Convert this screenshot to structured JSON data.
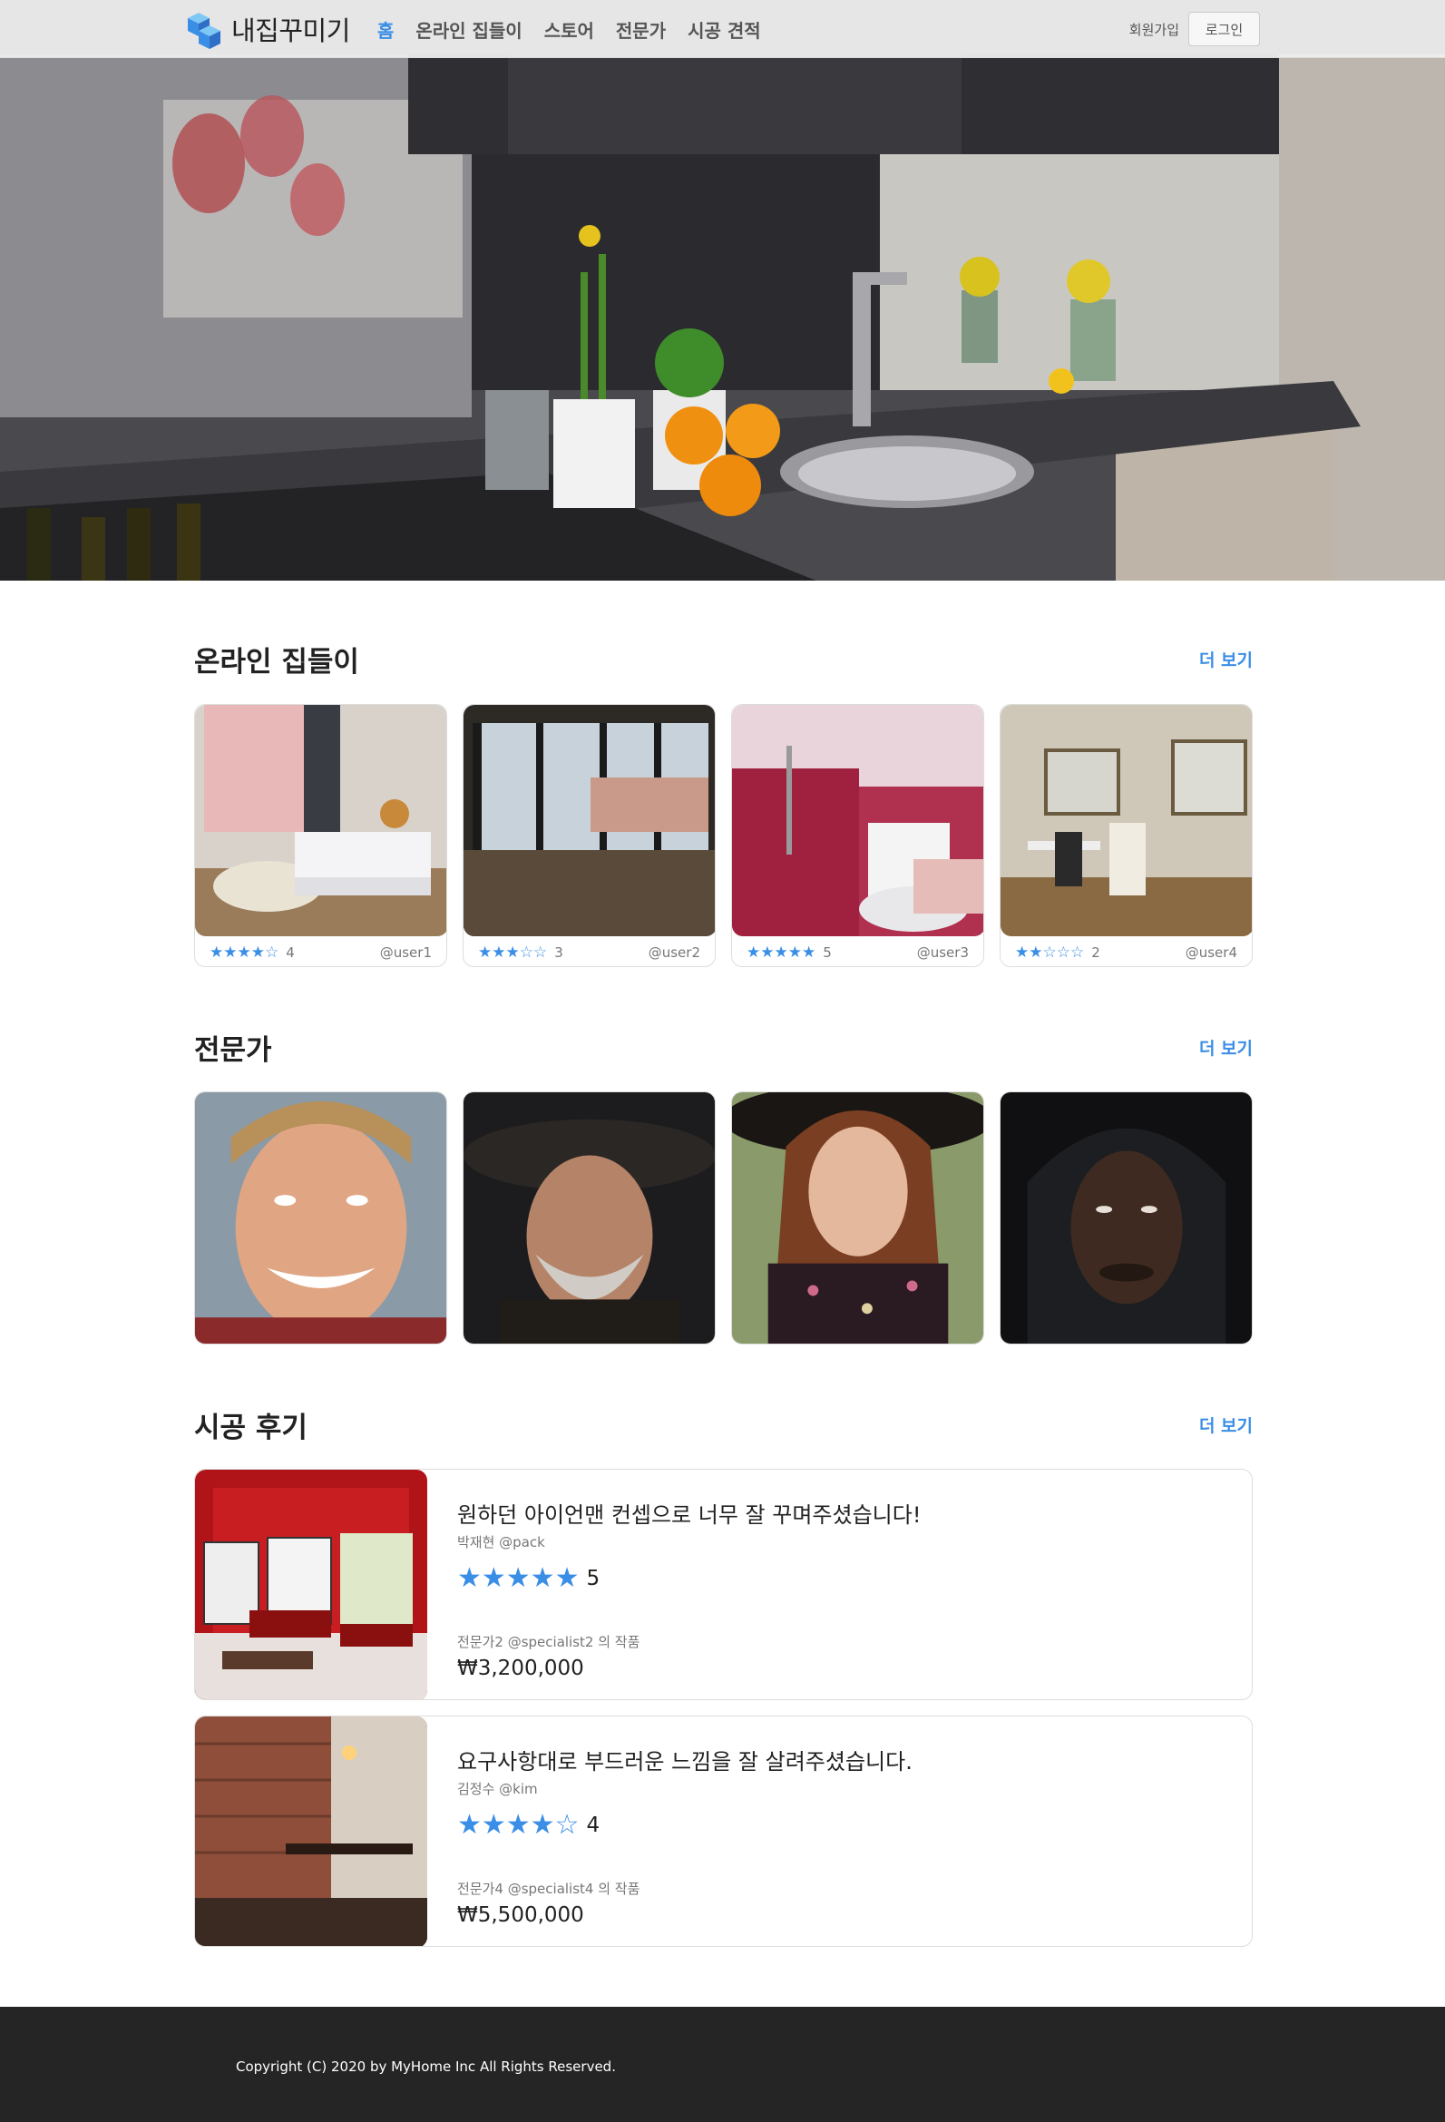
{
  "brand": {
    "name": "내집꾸미기",
    "accent": "#3a8ee6"
  },
  "nav": {
    "items": [
      {
        "label": "홈",
        "active": true
      },
      {
        "label": "온라인 집들이",
        "active": false
      },
      {
        "label": "스토어",
        "active": false
      },
      {
        "label": "전문가",
        "active": false
      },
      {
        "label": "시공 견적",
        "active": false
      }
    ],
    "signup": "회원가입",
    "login": "로그인"
  },
  "houses": {
    "title": "온라인 집들이",
    "more": "더 보기",
    "items": [
      {
        "stars": "★★★★☆",
        "rating": "4",
        "user": "@user1"
      },
      {
        "stars": "★★★☆☆",
        "rating": "3",
        "user": "@user2"
      },
      {
        "stars": "★★★★★",
        "rating": "5",
        "user": "@user3"
      },
      {
        "stars": "★★☆☆☆",
        "rating": "2",
        "user": "@user4"
      }
    ]
  },
  "experts": {
    "title": "전문가",
    "more": "더 보기"
  },
  "reviews": {
    "title": "시공 후기",
    "more": "더 보기",
    "items": [
      {
        "title": "원하던 아이언맨 컨셉으로 너무 잘 꾸며주셨습니다!",
        "author": "박재현 @pack",
        "stars": "★★★★★",
        "score": "5",
        "expert": "전문가2 @specialist2 의 작품",
        "price": "₩3,200,000"
      },
      {
        "title": "요구사항대로 부드러운 느낌을 잘 살려주셨습니다.",
        "author": "김정수 @kim",
        "stars": "★★★★☆",
        "score": "4",
        "expert": "전문가4 @specialist4 의 작품",
        "price": "₩5,500,000"
      }
    ]
  },
  "footer": {
    "copyright": "Copyright (C) 2020 by MyHome Inc All Rights Reserved."
  }
}
